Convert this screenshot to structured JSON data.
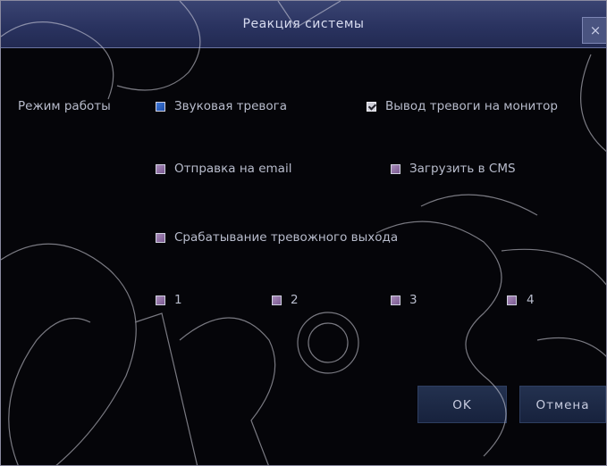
{
  "dialog": {
    "title": "Реакция системы",
    "close_label": "×",
    "close_icon": "close-icon"
  },
  "mode": {
    "label": "Режим работы",
    "options": {
      "sound_alarm": {
        "label": "Звуковая тревога",
        "checked": false,
        "color": "#3f78d8"
      },
      "alarm_to_monitor": {
        "label": "Вывод тревоги на монитор",
        "checked": true
      },
      "send_email": {
        "label": "Отправка на email",
        "checked": false
      },
      "upload_cms": {
        "label": "Загрузить в CMS",
        "checked": false
      },
      "alarm_output": {
        "label": "Срабатывание тревожного выхода",
        "checked": false
      }
    },
    "outputs": [
      {
        "label": "1",
        "checked": false
      },
      {
        "label": "2",
        "checked": false
      },
      {
        "label": "3",
        "checked": false
      },
      {
        "label": "4",
        "checked": false
      }
    ]
  },
  "buttons": {
    "ok": "OK",
    "cancel": "Отмена"
  },
  "colors": {
    "background": "#050509",
    "titlebar": "#2a3360",
    "checkbox": "#9a7ab0",
    "text": "#b8bccc"
  }
}
